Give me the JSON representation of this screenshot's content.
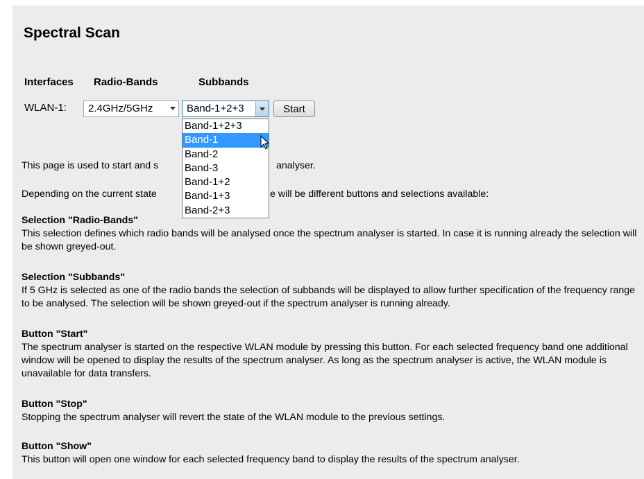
{
  "page": {
    "title": "Spectral Scan"
  },
  "form": {
    "headers": {
      "interfaces": "Interfaces",
      "radio_bands": "Radio-Bands",
      "subbands": "Subbands"
    },
    "interface_label": "WLAN-1:",
    "radio_bands_value": "2.4GHz/5GHz",
    "subbands_value": "Band-1+2+3",
    "start_label": "Start"
  },
  "dropdown": {
    "options": [
      "Band-1+2+3",
      "Band-1",
      "Band-2",
      "Band-3",
      "Band-1+2",
      "Band-1+3",
      "Band-2+3"
    ],
    "highlighted": "Band-1"
  },
  "description": {
    "intro1_a": "This page is used to start and s",
    "intro1_b": "analyser.",
    "intro2_a": "Depending on the current state",
    "intro2_b": "e will be different buttons and selections available:",
    "sections": [
      {
        "title": "Selection \"Radio-Bands\"",
        "text": "This selection defines which radio bands will be analysed once the spectrum analyser is started. In case it is running already the selection will be shown greyed-out."
      },
      {
        "title": "Selection \"Subbands\"",
        "text": "If 5 GHz is selected as one of the radio bands the selection of subbands will be displayed to allow further specification of the frequency range to be analysed. The selection will be shown greyed-out if the spectrum analyser is running already."
      },
      {
        "title": "Button \"Start\"",
        "text": "The spectrum analyser is started on the respective WLAN module by pressing this button. For each selected frequency band one additional window will be opened to display the results of the spectrum analyser. As long as the spectrum analyser is active, the WLAN module is unavailable for data transfers."
      },
      {
        "title": "Button \"Stop\"",
        "text": "Stopping the spectrum analyser will revert the state of the WLAN module to the previous settings."
      },
      {
        "title": "Button \"Show\"",
        "text": "This button will open one window for each selected frequency band to display the results of the spectrum analyser."
      }
    ]
  }
}
